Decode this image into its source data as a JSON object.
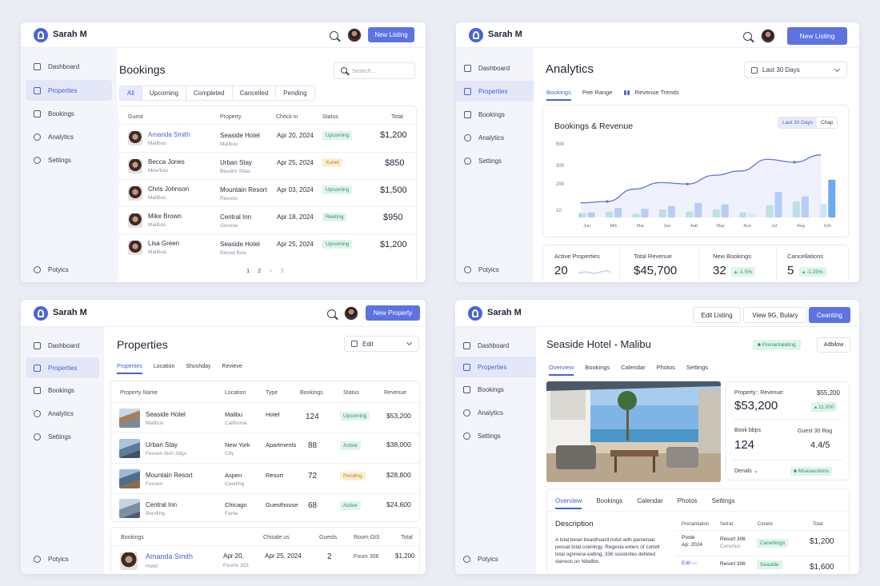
{
  "user_name": "Sarah M",
  "nav": [
    "Dashboard",
    "Properties",
    "Bookings",
    "Analytics",
    "Settings"
  ],
  "nav_footer": "Potyics",
  "bookings_panel": {
    "new_button": "New Listing",
    "title": "Bookings",
    "search_placeholder": "Search...",
    "filters": [
      "All",
      "Upcoming",
      "Completed",
      "Cancelled",
      "Pending"
    ],
    "headers": [
      "Guest",
      "Property",
      "Check in",
      "Status",
      "Total"
    ],
    "rows": [
      {
        "guest": "Amanda Smith",
        "guest_sub": "Mailboo",
        "property": "Seaside Hotel",
        "property_sub": "Malibus",
        "checkin": "Apr 20, 2024",
        "status": "Upcoming",
        "total": "$1,200"
      },
      {
        "guest": "Becca Jones",
        "guest_sub": "Mew'bos",
        "property": "Urban Stay",
        "property_sub": "Besdim Sltas",
        "checkin": "Apr 25, 2024",
        "status": "Xunet",
        "total": "$850"
      },
      {
        "guest": "Chris Johnson",
        "guest_sub": "Mailbus",
        "property": "Mountain Resort",
        "property_sub": "Resoos",
        "checkin": "Apr 03, 2024",
        "status": "Upcoming",
        "total": "$1,500"
      },
      {
        "guest": "Mike Brown",
        "guest_sub": "Mailboo",
        "property": "Central Inn",
        "property_sub": "Gesose",
        "checkin": "Apr 18, 2024",
        "status": "Reeting",
        "total": "$950"
      },
      {
        "guest": "Lisa Green",
        "guest_sub": "Mailbua",
        "property": "Seaside Hotel",
        "property_sub": "Resod Boa",
        "checkin": "Apr 25, 2024",
        "status": "Upcoming",
        "total": "$1,200"
      }
    ],
    "pages": [
      "1",
      "2",
      "»",
      "3"
    ]
  },
  "analytics_panel": {
    "new_button": "New Listing",
    "title": "Analytics",
    "range": "Last 30 Days",
    "tabs": [
      "Bookings",
      "Pee Range",
      "Revenue Trends"
    ],
    "chart_title": "Bookings & Revenue",
    "chart_toggle": [
      "Last 30 Days",
      "Chap"
    ],
    "stats": [
      {
        "label": "Active Properties",
        "value": "20"
      },
      {
        "label": "Total Revenue",
        "value": "$45,700"
      },
      {
        "label": "New Bookings",
        "value": "32",
        "badge": "-1.5%"
      },
      {
        "label": "Cancellations",
        "value": "5",
        "badge": "-1.25%"
      }
    ]
  },
  "chart_data": {
    "type": "bar",
    "title": "Bookings & Revenue",
    "categories": [
      "Jun",
      "Mih",
      "Mar",
      "Jun",
      "4att",
      "May",
      "Aus",
      "Jul",
      "Aeg",
      "Zeh"
    ],
    "yticks": [
      "500",
      "300",
      "200",
      "10"
    ],
    "ylim": [
      0,
      550
    ],
    "series": [
      {
        "values": [
          30,
          40,
          25,
          55,
          40,
          55,
          35,
          85,
          110,
          95
        ]
      },
      {
        "values": [
          35,
          65,
          60,
          80,
          100,
          90,
          30,
          175,
          145,
          260
        ]
      }
    ],
    "line": [
      100,
      110,
      195,
      240,
      230,
      290,
      320,
      400,
      380,
      430
    ],
    "grid": false,
    "colors": {
      "teal": "#7fd3cd",
      "blue": "#6ea8f0",
      "line": "#5d73e0"
    }
  },
  "properties_panel": {
    "new_button": "New Property",
    "title": "Properties",
    "select": "Edit",
    "tabs": [
      "Properties",
      "Location",
      "Shoshday",
      "Revieve"
    ],
    "headers": [
      "Property Name",
      "Location",
      "Type",
      "Bookings",
      "Status",
      "Revenue"
    ],
    "rows": [
      {
        "name": "Seaside Hotel",
        "sub": "Malibus",
        "loc": "Malibu",
        "loc_sub": "California",
        "type": "Hotel",
        "bookings": "124",
        "status": "Upcoming",
        "revenue": "$53,200"
      },
      {
        "name": "Urban Stay",
        "sub": "Fessen 8ish 3dgs",
        "loc": "New York",
        "loc_sub": "City",
        "type": "Apartments",
        "bookings": "88",
        "status": "Active",
        "revenue": "$38,000"
      },
      {
        "name": "Mountain Resort",
        "sub": "Fessen",
        "loc": "Aspen",
        "loc_sub": "Ceeding",
        "type": "Resort",
        "bookings": "72",
        "status": "Pending",
        "revenue": "$28,800"
      },
      {
        "name": "Central Inn",
        "sub": "Bending",
        "loc": "Chicago",
        "loc_sub": "Fame",
        "type": "Guesthouse",
        "bookings": "68",
        "status": "Active",
        "revenue": "$24,600"
      }
    ],
    "bookings_headers": [
      "Bookings",
      "Chisale us",
      "Guests",
      "Room GtS",
      "Total"
    ],
    "booking_row": {
      "guest": "Amanda Smith",
      "guest_sub": "Hotel",
      "date1": "Apr 20,",
      "date1_sub": "Fesnis 303",
      "date2": "Apr 25, 2024",
      "guests": "2",
      "room": "Foum 306",
      "total": "$1,200"
    }
  },
  "detail_panel": {
    "buttons": [
      "Edit Listing",
      "View 9G, Bulary",
      "Ceanting"
    ],
    "title": "Seaside Hotel",
    "title_sep": "-",
    "location": "Malibu",
    "badge": "Prenantalating",
    "btn_side": "Adbilow",
    "tabs_top": [
      "Overview",
      "Bookings",
      "Calendar",
      "Photos",
      "Settings"
    ],
    "revenue_label": "Property:: Revenue:",
    "revenue_value": "$53,200",
    "revenue_small": "$55,200",
    "revenue_badge": "11,000",
    "book_label": "Book bbps",
    "book_value": "124",
    "guest_label": "Guest 30 Rog",
    "guest_value": "4.4/5",
    "denals": "Denals",
    "denals_badge": "Msasauolons",
    "tabs_bottom": [
      "Overview",
      "Bookings",
      "Calendar",
      "Photos",
      "Settings"
    ],
    "desc_title": "Description",
    "desc_text": "A lotal besel beasthoard hotut with parnenaic pessat total coenlngy. Regesta exters of cortett total ognnena ealting, 336 sosstintes defeted stanoos un hibalibo.",
    "table_headers": [
      "Prenantation",
      "Setrat",
      "Cenets",
      "Total"
    ],
    "table_rows": [
      {
        "col1": "Poste",
        "col1_sub": "Ap: 2024",
        "col2": "Resort 306",
        "col2_sub": "Cenchus",
        "badge": "Canehings",
        "total": "$1,200"
      },
      {
        "col1": "Edit",
        "col1_sub": "",
        "col2": "Resort 306",
        "col2_sub": "",
        "badge": "Seaside",
        "total": "$1,600"
      }
    ]
  }
}
